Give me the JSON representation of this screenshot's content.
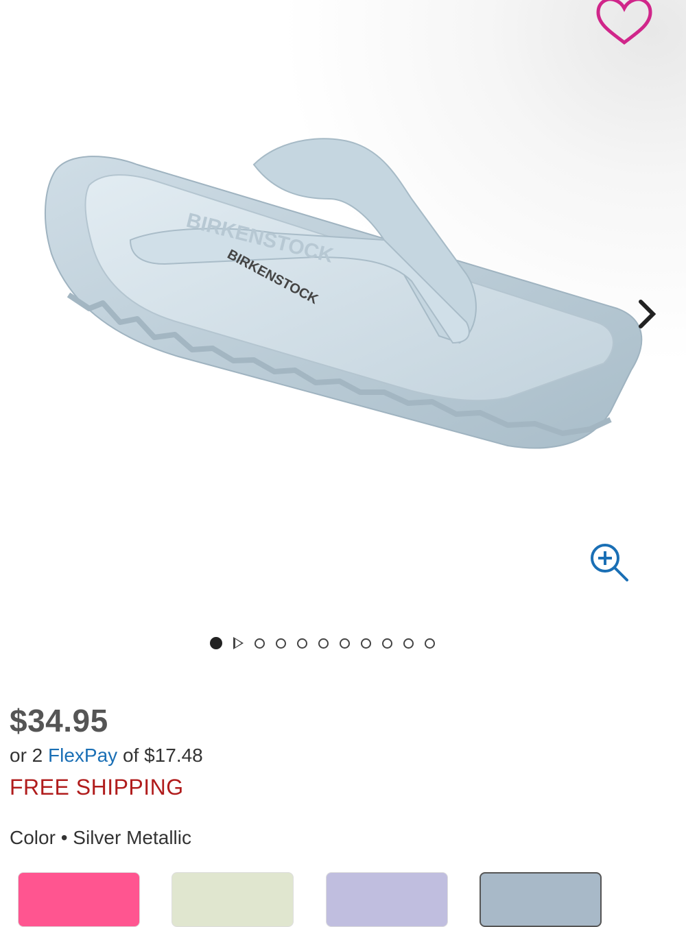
{
  "product": {
    "image_alt": "BIRKENSTOCK",
    "price": "$34.95",
    "flexpay_prefix": "or 2",
    "flexpay_link": "FlexPay",
    "flexpay_suffix": "of $17.48",
    "shipping": "FREE SHIPPING",
    "color_label": "Color",
    "color_separator": "•",
    "color_value": "Silver Metallic"
  },
  "gallery": {
    "dot_count": 11,
    "active_index": 0,
    "icons": [
      "heart-icon",
      "chevron-right-icon",
      "zoom-in-icon",
      "play-icon"
    ]
  },
  "swatches": [
    {
      "name": "pink",
      "color": "#ff5590"
    },
    {
      "name": "sage",
      "color": "#e0e6cf"
    },
    {
      "name": "lavender",
      "color": "#c0bedf"
    },
    {
      "name": "silver-blue",
      "color": "#a8b9c8",
      "selected": true
    }
  ],
  "colors": {
    "accent_heart": "#d0268a",
    "link": "#1a6fb5",
    "shipping": "#b01c1c",
    "zoom_icon": "#1a6fb5"
  }
}
